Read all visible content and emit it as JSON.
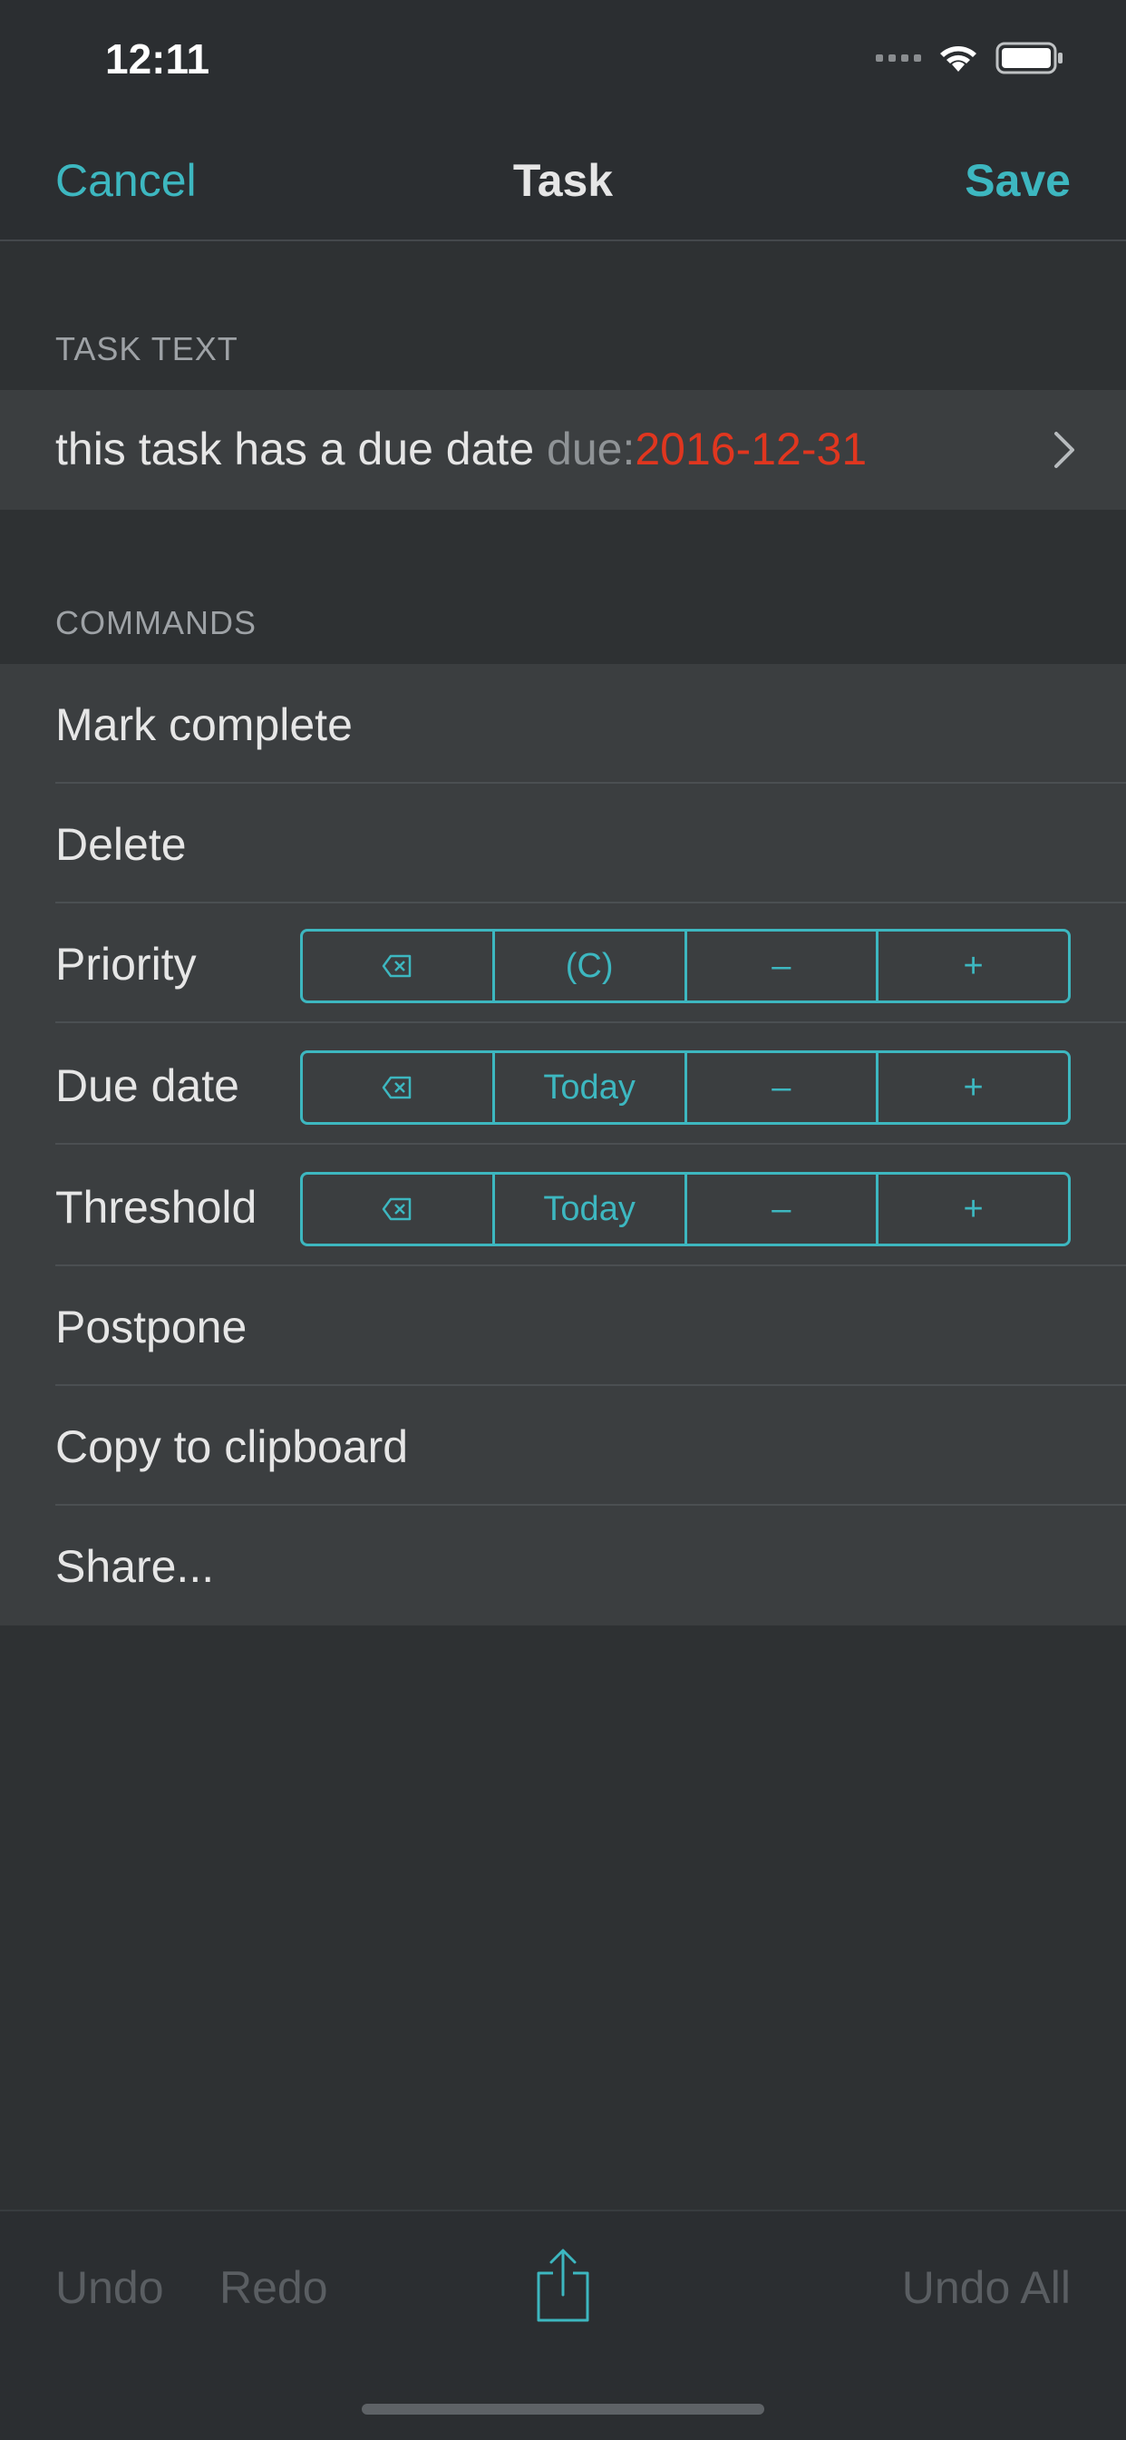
{
  "status_bar": {
    "time": "12:11"
  },
  "nav": {
    "cancel": "Cancel",
    "title": "Task",
    "save": "Save"
  },
  "task_section": {
    "header": "TASK TEXT",
    "text": "this task has a due date ",
    "due_key": "due:",
    "due_value": "2016-12-31"
  },
  "commands_section": {
    "header": "COMMANDS",
    "mark_complete": "Mark complete",
    "delete": "Delete",
    "priority": {
      "label": "Priority",
      "clear": "⌫",
      "value": "(C)",
      "minus": "–",
      "plus": "+"
    },
    "due_date": {
      "label": "Due date",
      "clear": "⌫",
      "value": "Today",
      "minus": "–",
      "plus": "+"
    },
    "threshold": {
      "label": "Threshold",
      "clear": "⌫",
      "value": "Today",
      "minus": "–",
      "plus": "+"
    },
    "postpone": "Postpone",
    "copy": "Copy to clipboard",
    "share": "Share..."
  },
  "toolbar": {
    "undo": "Undo",
    "redo": "Redo",
    "undo_all": "Undo All",
    "share_icon": "share-icon"
  },
  "colors": {
    "accent": "#3db7c0",
    "due": "#e0361f",
    "background": "#2e3133",
    "cell": "#3b3e40"
  }
}
